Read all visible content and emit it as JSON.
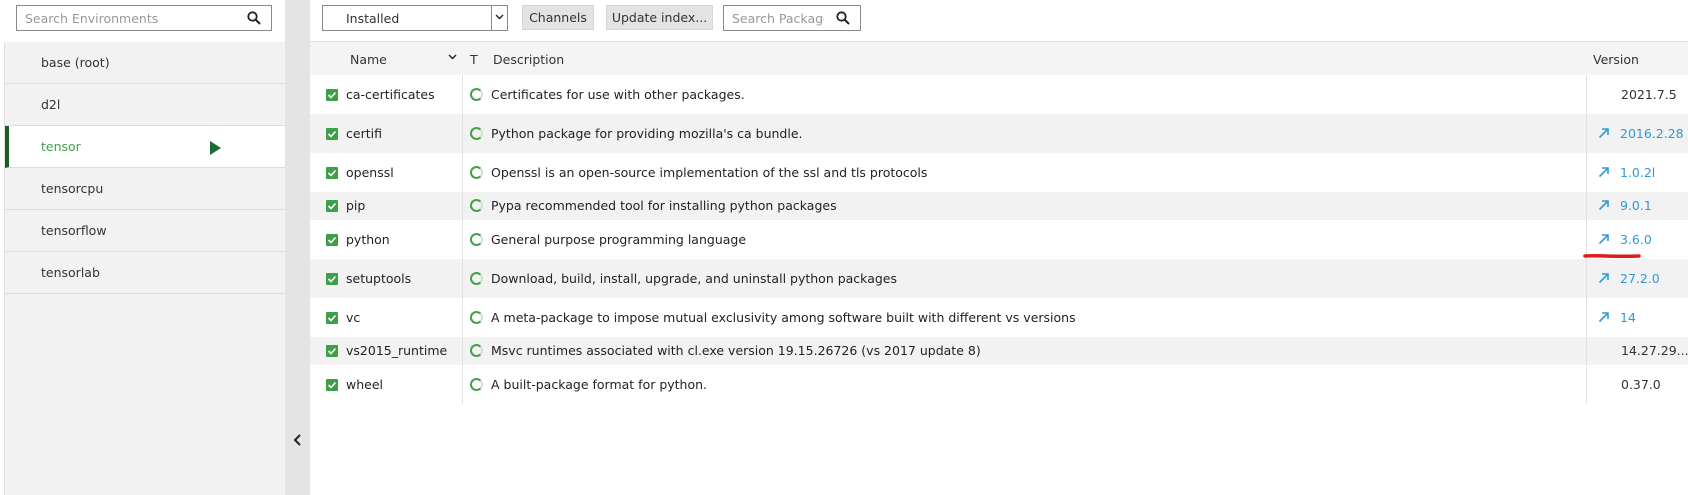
{
  "sidebar": {
    "search": {
      "placeholder": "Search Environments",
      "icon": "search-icon"
    },
    "environments": [
      {
        "name": "base (root)",
        "active": false
      },
      {
        "name": "d2l",
        "active": false
      },
      {
        "name": "tensor",
        "active": true
      },
      {
        "name": "tensorcpu",
        "active": false
      },
      {
        "name": "tensorflow",
        "active": false
      },
      {
        "name": "tensorlab",
        "active": false
      }
    ]
  },
  "toolbar": {
    "filter_selected": "Installed",
    "channels_label": "Channels",
    "update_index_label": "Update index...",
    "search_placeholder": "Search Packages"
  },
  "table": {
    "headers": {
      "name": "Name",
      "t": "T",
      "description": "Description",
      "version": "Version"
    },
    "rows": [
      {
        "name": "ca-certificates",
        "description": "Certificates for use with other packages.",
        "version": "2021.7.5",
        "update_available": false
      },
      {
        "name": "certifi",
        "description": "Python package for providing mozilla's ca bundle.",
        "version": "2016.2.28",
        "update_available": true
      },
      {
        "name": "openssl",
        "description": "Openssl is an open-source implementation of the ssl and tls protocols",
        "version": "1.0.2l",
        "update_available": true
      },
      {
        "name": "pip",
        "description": "Pypa recommended tool for installing python packages",
        "version": "9.0.1",
        "update_available": true
      },
      {
        "name": "python",
        "description": "General purpose programming language",
        "version": "3.6.0",
        "update_available": true
      },
      {
        "name": "setuptools",
        "description": "Download, build, install, upgrade, and uninstall python packages",
        "version": "27.2.0",
        "update_available": true
      },
      {
        "name": "vc",
        "description": "A meta-package to impose mutual exclusivity among software built with different vs versions",
        "version": "14",
        "update_available": true
      },
      {
        "name": "vs2015_runtime",
        "description": "Msvc runtimes associated with cl.exe version 19.15.26726 (vs 2017 update 8)",
        "version": "14.27.29...",
        "update_available": false
      },
      {
        "name": "wheel",
        "description": "A built-package format for python.",
        "version": "0.37.0",
        "update_available": false
      }
    ]
  },
  "colors": {
    "accent_green": "#43a047",
    "active_bar": "#1b5e20",
    "link_blue": "#2d9bd6",
    "annotation_red": "#e01a1a"
  }
}
